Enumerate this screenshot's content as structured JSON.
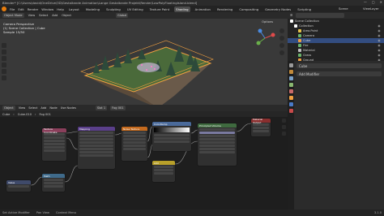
{
  "titlebar": {
    "text": "Blender* [C:\\Users\\david\\OneDrive\\3D\\Gestaltande Animation\\Lange Gestaltande Projekt\\Render\\LowPolyFloatingIsland.blend]",
    "min": "—",
    "max": "▢",
    "close": "✕"
  },
  "menu": {
    "items": [
      "File",
      "Edit",
      "Render",
      "Window",
      "Help"
    ],
    "workspaces": [
      "Layout",
      "Modeling",
      "Sculpting",
      "UV Editing",
      "Texture Paint",
      "Shading",
      "Animation",
      "Rendering",
      "Compositing",
      "Geometry Nodes",
      "Scripting"
    ],
    "active_workspace": "Shading",
    "scene": "Scene",
    "view_layer": "ViewLayer"
  },
  "viewport": {
    "mode": "Object Mode",
    "menus": [
      "View",
      "Select",
      "Add",
      "Object"
    ],
    "transform": "Global",
    "info": [
      "Camera Perspective",
      "(1) Scene Collection | Cube",
      "Sample 15/50"
    ],
    "options": "Options"
  },
  "outliner": {
    "title": "Scene Collection",
    "items": [
      {
        "label": "Collection",
        "color": "#ffffff",
        "selected": false,
        "indent": 1
      },
      {
        "label": "Area.Point",
        "color": "#e6c14a",
        "selected": false,
        "indent": 2
      },
      {
        "label": "Camera",
        "color": "#6bb56b",
        "selected": false,
        "indent": 2
      },
      {
        "label": "Cube",
        "color": "#f0a040",
        "selected": true,
        "indent": 2
      },
      {
        "label": "Fire",
        "color": "#6bb56b",
        "selected": false,
        "indent": 2
      },
      {
        "label": "Material",
        "color": "#c0c0c0",
        "selected": false,
        "indent": 2
      },
      {
        "label": "Grass",
        "color": "#6bb56b",
        "selected": false,
        "indent": 2
      },
      {
        "label": "Ground",
        "color": "#f0a040",
        "selected": false,
        "indent": 2
      }
    ]
  },
  "properties": {
    "object": "Cube",
    "add_modifier": "Add Modifier"
  },
  "node_editor": {
    "menus": [
      "View",
      "Select",
      "Add",
      "Node"
    ],
    "object": "Object",
    "use_nodes": "Use Nodes",
    "slot": "Slot 1",
    "material": "Fog 001",
    "breadcrumb": [
      "Cube",
      "Cube.010",
      "Fog 001"
    ]
  },
  "nodes": [
    {
      "name": "Texture Coordinate",
      "color": "#8a3f5b"
    },
    {
      "name": "Mapping",
      "color": "#5a3f8a"
    },
    {
      "name": "Noise Texture",
      "color": "#c46a1e"
    },
    {
      "name": "ColorRamp",
      "color": "#4a6a9a"
    },
    {
      "name": "Principled Volume",
      "color": "#3f6a3f"
    },
    {
      "name": "Material Output",
      "color": "#8a2f2f"
    },
    {
      "name": "Value",
      "color": "#3f4a6a"
    },
    {
      "name": "Math",
      "color": "#3f6a8a"
    },
    {
      "name": "Add",
      "color": "#b8a02a"
    }
  ],
  "status": {
    "items": [
      "Set Active Modifier",
      "Pan View",
      "Context Menu"
    ],
    "version": "3.1.0"
  }
}
